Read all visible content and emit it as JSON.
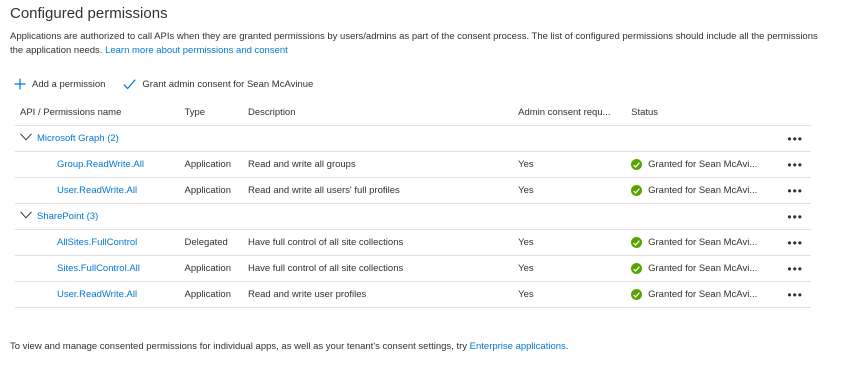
{
  "title": "Configured permissions",
  "description": "Applications are authorized to call APIs when they are granted permissions by users/admins as part of the consent process. The list of configured permissions should include all the permissions the application needs.",
  "learn_more_link": "Learn more about permissions and consent",
  "toolbar": {
    "add_permission": "Add a permission",
    "grant_consent": "Grant admin consent for Sean McAvinue"
  },
  "columns": {
    "name": "API / Permissions name",
    "type": "Type",
    "description": "Description",
    "admin": "Admin consent requ...",
    "status": "Status"
  },
  "groups": [
    {
      "label": "Microsoft Graph (2)",
      "permissions": [
        {
          "name": "Group.ReadWrite.All",
          "type": "Application",
          "description": "Read and write all groups",
          "admin": "Yes",
          "status": "Granted for Sean McAvi..."
        },
        {
          "name": "User.ReadWrite.All",
          "type": "Application",
          "description": "Read and write all users' full profiles",
          "admin": "Yes",
          "status": "Granted for Sean McAvi..."
        }
      ]
    },
    {
      "label": "SharePoint (3)",
      "permissions": [
        {
          "name": "AllSites.FullControl",
          "type": "Delegated",
          "description": "Have full control of all site collections",
          "admin": "Yes",
          "status": "Granted for Sean McAvi..."
        },
        {
          "name": "Sites.FullControl.All",
          "type": "Application",
          "description": "Have full control of all site collections",
          "admin": "Yes",
          "status": "Granted for Sean McAvi..."
        },
        {
          "name": "User.ReadWrite.All",
          "type": "Application",
          "description": "Read and write user profiles",
          "admin": "Yes",
          "status": "Granted for Sean McAvi..."
        }
      ]
    }
  ],
  "more_glyph": "•••",
  "footer": {
    "text": "To view and manage consented permissions for individual apps, as well as your tenant's consent settings, try",
    "link": "Enterprise applications",
    "end": "."
  },
  "colors": {
    "link": "#0078d4",
    "granted": "#57a300",
    "border": "#e1dfdd"
  }
}
